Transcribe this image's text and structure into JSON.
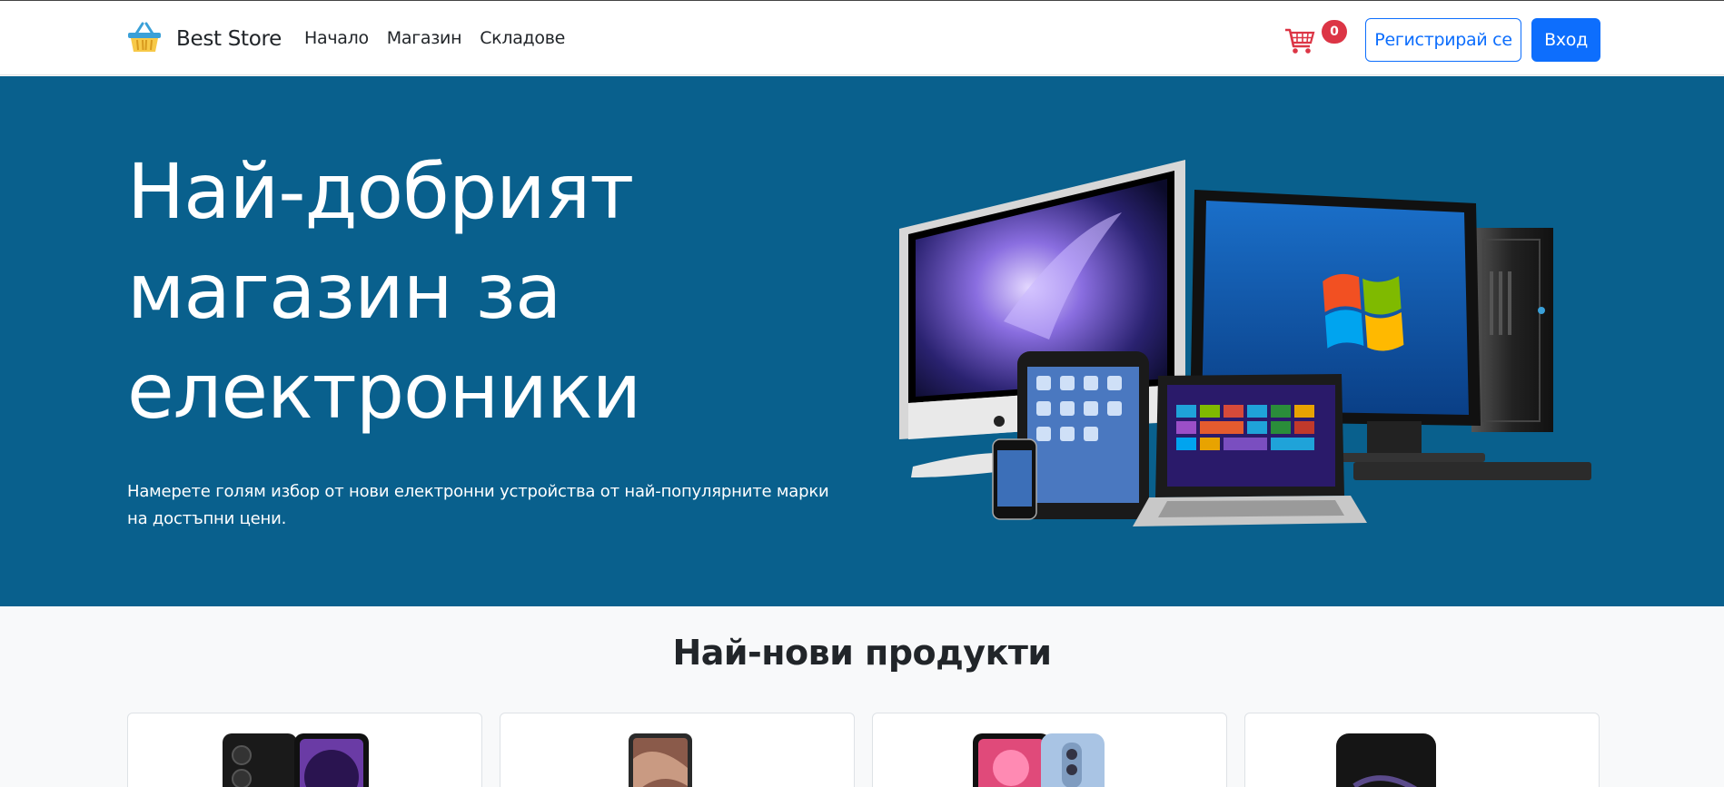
{
  "navbar": {
    "brand": "Best Store",
    "links": [
      {
        "label": "Начало"
      },
      {
        "label": "Магазин"
      },
      {
        "label": "Складове"
      }
    ],
    "cart_count": "0",
    "register_label": "Регистрирай се",
    "login_label": "Вход"
  },
  "hero": {
    "title": "Най-добрият магазин за електроники",
    "text": "Намерете голям избор от нови електронни устройства от най-популярните марки на достъпни цени."
  },
  "products_section": {
    "title": "Най-нови продукти"
  },
  "colors": {
    "primary": "#0d6efd",
    "hero_bg": "#09608d",
    "badge": "#dc3545",
    "page_bg": "#f8f9fa"
  },
  "icons": [
    "basket-logo-icon",
    "shopping-cart-icon"
  ]
}
